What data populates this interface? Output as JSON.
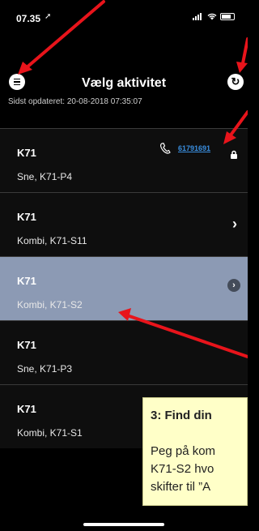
{
  "status_bar": {
    "time": "07.35",
    "location_glyph": "➚"
  },
  "header": {
    "title": "Vælg aktivitet",
    "updated": "Sidst opdateret: 20-08-2018 07:35:07",
    "menu_icon": "hamburger-icon",
    "refresh_icon": "refresh-icon",
    "refresh_glyph": "↻"
  },
  "list": {
    "items": [
      {
        "code": "K71",
        "desc": "Sne, K71-P4",
        "phone": "61791691",
        "trailing": "lock"
      },
      {
        "code": "K71",
        "desc": "Kombi, K71-S11",
        "trailing": "chevron"
      },
      {
        "code": "K71",
        "desc": "Kombi, K71-S2",
        "trailing": "chevron-circle",
        "selected": true
      },
      {
        "code": "K71",
        "desc": "Sne, K71-P3",
        "trailing": "none"
      },
      {
        "code": "K71",
        "desc": "Kombi, K71-S1",
        "trailing": "none"
      }
    ],
    "chevron_glyph": "›"
  },
  "tooltip": {
    "title": "3: Find din",
    "lines": [
      "Peg på kom",
      "K71-S2 hvo",
      "skifter til ”A"
    ]
  },
  "colors": {
    "selected_row": "#8c9ab4",
    "tooltip_bg": "#ffffc8",
    "annotation_arrow": "#e8141b",
    "phone_link": "#3a8fe0"
  }
}
